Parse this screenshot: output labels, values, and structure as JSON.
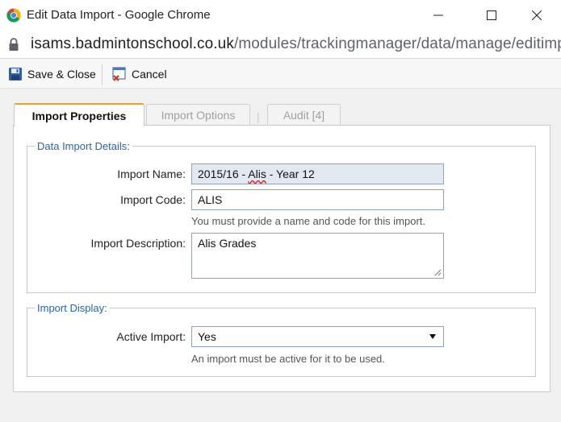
{
  "window": {
    "title": "Edit Data Import - Google Chrome",
    "minimize_icon": "minimize-icon",
    "maximize_icon": "maximize-icon",
    "close_icon": "close-icon"
  },
  "address": {
    "host": "isams.badmintonschool.co.uk",
    "path": "/modules/trackingmanager/data/manage/editimp..."
  },
  "toolbar": {
    "save_label": "Save & Close",
    "cancel_label": "Cancel"
  },
  "tabs": [
    {
      "label": "Import Properties",
      "active": true
    },
    {
      "label": "Import Options",
      "active": false
    },
    {
      "label": "Audit [4]",
      "active": false
    }
  ],
  "tab_separator": "|",
  "details": {
    "legend": "Data Import Details:",
    "name_label": "Import Name:",
    "name_value_prefix": "2015/16 - ",
    "name_value_flagged": "Alis",
    "name_value_suffix": " - Year 12",
    "code_label": "Import Code:",
    "code_value": "ALIS",
    "code_hint": "You must provide a name and code for this import.",
    "description_label": "Import Description:",
    "description_value": "Alis Grades"
  },
  "display": {
    "legend": "Import Display:",
    "active_label": "Active Import:",
    "active_value": "Yes",
    "active_hint": "An import must be active for it to be used."
  },
  "colors": {
    "accent_tab": "#f0a020",
    "legend_blue": "#2a62b8",
    "readonly_bg": "#e2e8f0"
  }
}
